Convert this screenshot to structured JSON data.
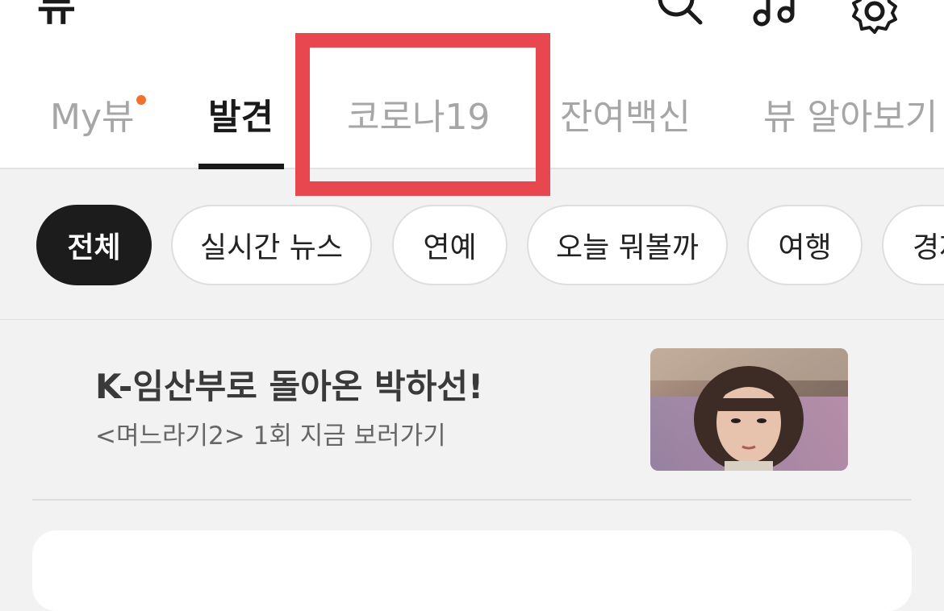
{
  "header": {
    "title": "뷰"
  },
  "icons": {
    "search": "search-icon",
    "music": "music-icon",
    "settings": "gear-icon"
  },
  "tabs": [
    {
      "label": "My뷰",
      "active": false,
      "has_dot": true
    },
    {
      "label": "발견",
      "active": true
    },
    {
      "label": "코로나19",
      "active": false,
      "highlighted": true
    },
    {
      "label": "잔여백신",
      "active": false
    },
    {
      "label": "뷰 알아보기",
      "active": false
    }
  ],
  "chips": [
    {
      "label": "전체",
      "selected": true
    },
    {
      "label": "실시간 뉴스",
      "selected": false
    },
    {
      "label": "연예",
      "selected": false
    },
    {
      "label": "오늘 뭐볼까",
      "selected": false
    },
    {
      "label": "여행",
      "selected": false
    },
    {
      "label": "경제",
      "selected": false
    }
  ],
  "promo": {
    "title": "K-임산부로 돌아온 박하선!",
    "subtitle": "<며느라기2> 1회 지금 보러가기"
  },
  "colors": {
    "accent_dot": "#f07030",
    "highlight": "#e8474f",
    "active_chip_bg": "#1c1c1c"
  }
}
